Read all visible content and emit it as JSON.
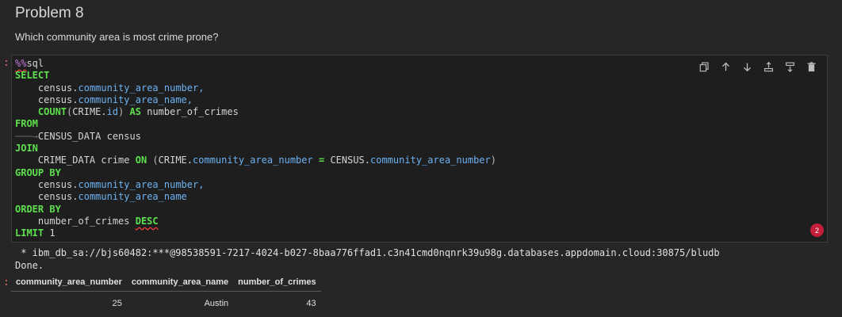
{
  "heading": "Problem 8",
  "question": "Which community area is most crime prone?",
  "prompt_marker": ":",
  "code": {
    "magic_pct": "%%",
    "magic_word": "sql",
    "kw_select": "SELECT",
    "kw_from": "FROM",
    "kw_join": "JOIN",
    "kw_on": "ON",
    "kw_group_by": "GROUP BY",
    "kw_order_by": "ORDER BY",
    "kw_desc": "DESC",
    "kw_limit": "LIMIT",
    "kw_count": "COUNT",
    "kw_as": "AS",
    "census": "census",
    "crime_upper": "CRIME",
    "census_upper": "CENSUS",
    "dot": ".",
    "comma": ",",
    "eq": "=",
    "attr_number": "community_area_number",
    "attr_name": "community_area_name",
    "attr_id": "id",
    "alias": "number_of_crimes",
    "census_table": "CENSUS_DATA census",
    "crime_table": "CRIME_DATA crime",
    "limit_value": "1",
    "tab_arrow": "───→"
  },
  "toolbar": {
    "copy_icon": "copy-icon",
    "up_icon": "arrow-up-icon",
    "down_icon": "arrow-down-icon",
    "insert_above_icon": "insert-above-icon",
    "insert_below_icon": "insert-below-icon",
    "delete_icon": "trash-icon"
  },
  "badge_count": "2",
  "output": {
    "connection": " * ibm_db_sa://bjs60482:***@98538591-7217-4024-b027-8baa776ffad1.c3n41cmd0nqnrk39u98g.databases.appdomain.cloud:30875/bludb",
    "done": "Done."
  },
  "result_table": {
    "headers": [
      "community_area_number",
      "community_area_name",
      "number_of_crimes"
    ],
    "rows": [
      [
        "25",
        "Austin",
        "43"
      ]
    ]
  },
  "colors": {
    "background": "#262626",
    "cell_background": "#1e1e1e",
    "keyword": "#5ee04e",
    "attribute": "#6cb2f2",
    "badge": "#c41e3a"
  }
}
